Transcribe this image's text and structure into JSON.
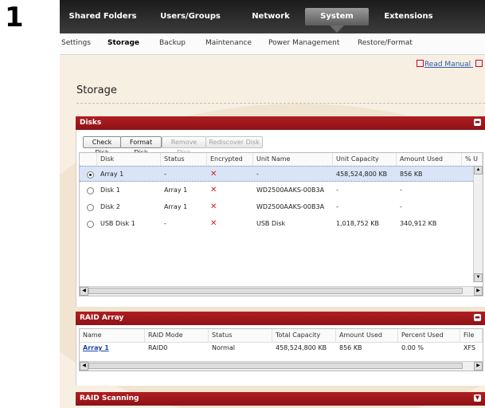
{
  "step_number": "1",
  "topnav": {
    "items": [
      {
        "label": "Shared Folders"
      },
      {
        "label": "Users/Groups"
      },
      {
        "label": "Network"
      },
      {
        "label": "System"
      },
      {
        "label": "Extensions"
      }
    ],
    "active": "System"
  },
  "subnav": {
    "items": [
      {
        "label": "Settings"
      },
      {
        "label": "Storage"
      },
      {
        "label": "Backup"
      },
      {
        "label": "Maintenance"
      },
      {
        "label": "Power Management"
      },
      {
        "label": "Restore/Format"
      }
    ],
    "active": "Storage"
  },
  "read_manual": "Read Manual",
  "page_title": "Storage",
  "disks": {
    "title": "Disks",
    "toolbar": {
      "check_disk": "Check Disk",
      "format_disk": "Format Disk",
      "remove_disk": "Remove Disk",
      "rediscover_disk": "Rediscover Disk"
    },
    "columns": [
      "Disk",
      "Status",
      "Encrypted",
      "Unit Name",
      "Unit Capacity",
      "Amount Used",
      "% U"
    ],
    "rows": [
      {
        "disk": "Array 1",
        "status": "-",
        "encrypted": "✕",
        "unit_name": "-",
        "unit_capacity": "458,524,800 KB",
        "amount_used": "856 KB",
        "selected": true
      },
      {
        "disk": "Disk 1",
        "status": "Array 1",
        "encrypted": "✕",
        "unit_name": "WD2500AAKS-00B3A",
        "unit_capacity": "-",
        "amount_used": "-",
        "selected": false
      },
      {
        "disk": "Disk 2",
        "status": "Array 1",
        "encrypted": "✕",
        "unit_name": "WD2500AAKS-00B3A",
        "unit_capacity": "-",
        "amount_used": "-",
        "selected": false
      },
      {
        "disk": "USB Disk 1",
        "status": "-",
        "encrypted": "✕",
        "unit_name": "USB Disk",
        "unit_capacity": "1,018,752 KB",
        "amount_used": "340,912 KB",
        "selected": false
      }
    ]
  },
  "raid": {
    "title": "RAID Array",
    "columns": [
      "Name",
      "RAID Mode",
      "Status",
      "Total Capacity",
      "Amount Used",
      "Percent Used",
      "File"
    ],
    "rows": [
      {
        "name": "Array 1",
        "raid_mode": "RAID0",
        "status": "Normal",
        "total_capacity": "458,524,800 KB",
        "amount_used": "856 KB",
        "percent_used": "0.00 %",
        "file": "XFS"
      }
    ]
  },
  "raid_scanning": {
    "title": "RAID Scanning"
  },
  "colors": {
    "accent_red": "#9e181c",
    "topnav_dark": "#2a2a2a",
    "background_cream": "#f7efe2",
    "selection_blue": "#d9e4f6",
    "link_blue": "#1d4aa6",
    "x_red": "#d31f1f"
  },
  "icons": {
    "collapse": "minus-icon",
    "expand": "chevron-down-icon",
    "external_link": "external-link-icon"
  }
}
